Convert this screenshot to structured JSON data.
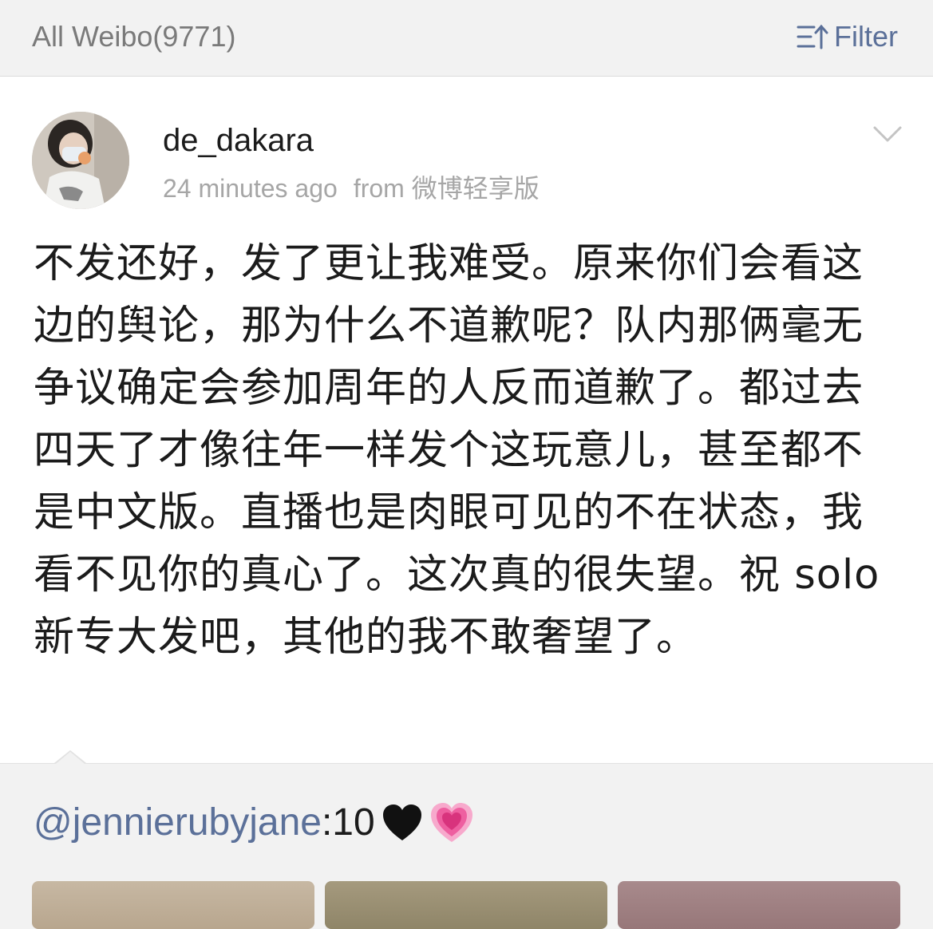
{
  "header": {
    "title": "All Weibo(9771)",
    "filter_label": "Filter"
  },
  "post": {
    "username": "de_dakara",
    "time": "24 minutes ago",
    "source": "from 微博轻享版",
    "text": "不发还好，发了更让我难受。原来你们会看这边的舆论，那为什么不道歉呢？队内那俩毫无争议确定会参加周年的人反而道歉了。都过去四天了才像往年一样发个这玩意儿，甚至都不是中文版。直播也是肉眼可见的不在状态，我看不见你的真心了。这次真的很失望。祝 solo 新专大发吧，其他的我不敢奢望了。"
  },
  "repost": {
    "mention": "@jennierubyjane",
    "text": ":10",
    "emojis": [
      "black-heart-icon",
      "growing-heart-icon"
    ]
  },
  "colors": {
    "link": "#5b7099",
    "text": "#1b1b1b",
    "muted": "#a6a6a6",
    "background": "#f2f2f2"
  }
}
